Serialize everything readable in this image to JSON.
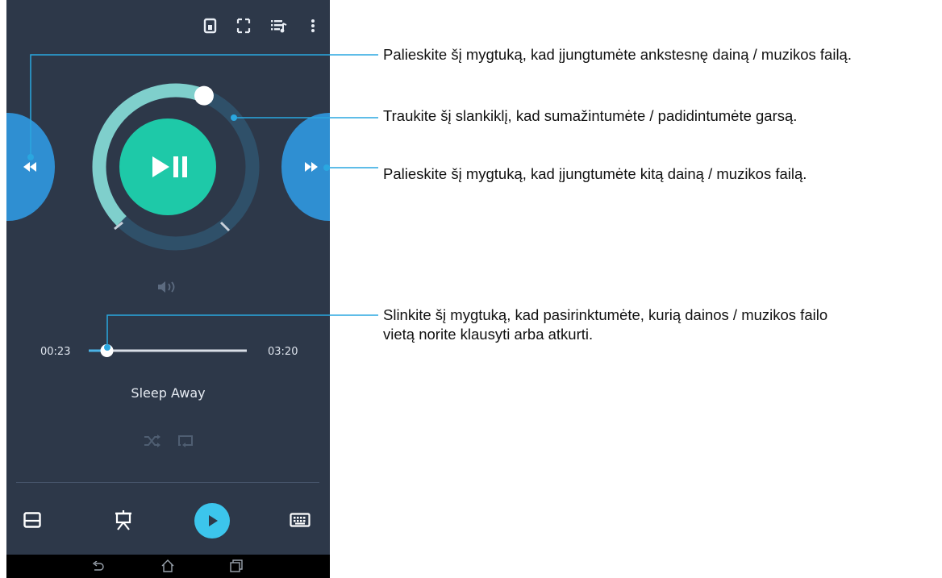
{
  "player": {
    "elapsed_time": "00:23",
    "total_time": "03:20",
    "song_title": "Sleep Away",
    "progress": 0.115,
    "volume": 0.58
  },
  "icons": {
    "top_bar": [
      "cast-icon",
      "fullscreen-icon",
      "playlist-icon",
      "more-options-icon"
    ],
    "transport": [
      "rewind-icon",
      "play-pause-icon",
      "fast-forward-icon"
    ],
    "modes": [
      "volume-icon",
      "shuffle-icon",
      "repeat-icon"
    ],
    "bottom_bar": [
      "touchpad-icon",
      "presentation-icon",
      "play-icon",
      "keyboard-icon"
    ],
    "system_nav": [
      "back-icon",
      "home-icon",
      "recent-apps-icon"
    ]
  },
  "colors": {
    "background": "#2d3849",
    "accent_teal": "#1ec9a8",
    "volume_ring": "#7fcfcc",
    "side_buttons": "#2f8fd2",
    "play_button": "#3cc5ec"
  },
  "annotations": {
    "previous": "Palieskite šį mygtuką, kad įjungtumėte ankstesnę dainą / muzikos failą.",
    "volume": "Traukite šį slankiklį, kad sumažintumėte / padidintumėte garsą.",
    "next": "Palieskite šį mygtuką, kad įjungtumėte kitą dainą / muzikos failą.",
    "seek_line1": "Slinkite šį mygtuką, kad pasirinktumėte, kurią dainos / muzikos failo",
    "seek_line2": "vietą norite klausyti arba atkurti."
  }
}
